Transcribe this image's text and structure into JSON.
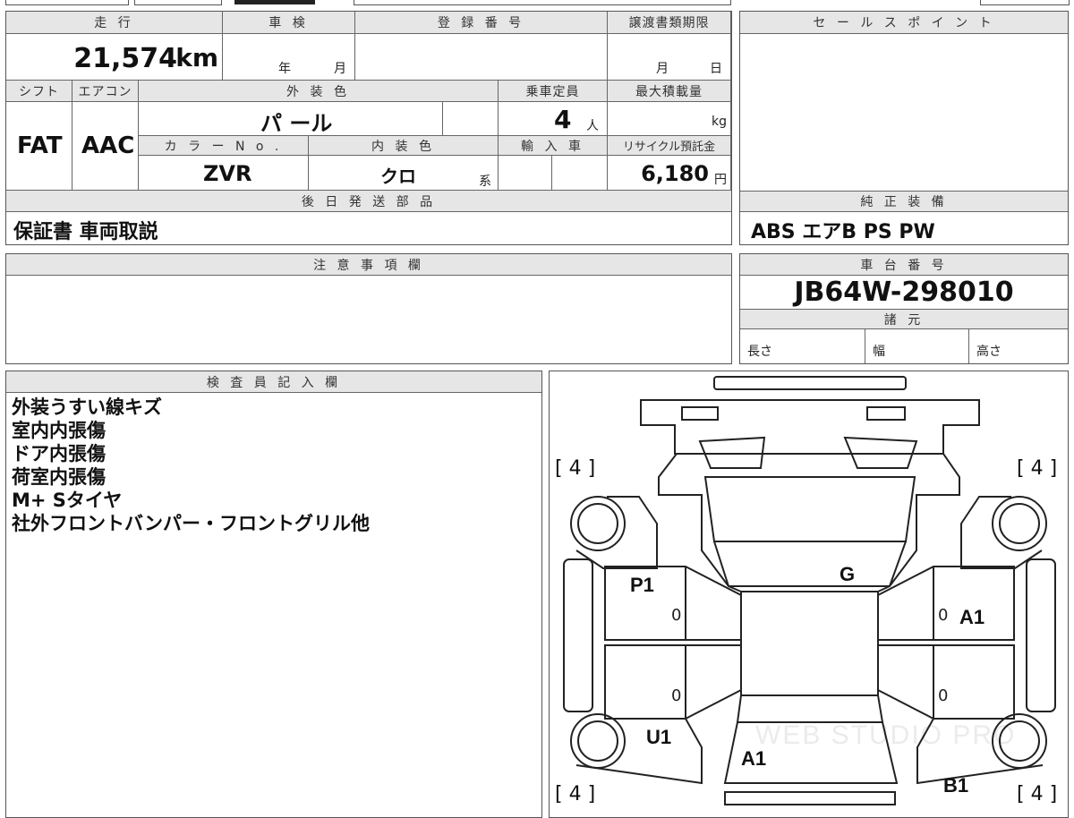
{
  "mileage": {
    "header": "走 行",
    "value": "21,574",
    "unit": "km"
  },
  "shaken": {
    "header": "車 検",
    "year_unit": "年",
    "month_unit": "月"
  },
  "registration": {
    "header": "登 録 番 号"
  },
  "transfer_deadline": {
    "header": "譲渡書類期限",
    "month_unit": "月",
    "day_unit": "日"
  },
  "sales_point": {
    "header": "セ ー ル ス ポ イ ン ト"
  },
  "shift": {
    "header": "シフト",
    "value": "FAT"
  },
  "aircon": {
    "header": "エアコン",
    "value": "AAC"
  },
  "exterior_color": {
    "header": "外 装 色",
    "value": "パ ール"
  },
  "capacity": {
    "header": "乗車定員",
    "value": "4",
    "unit": "人"
  },
  "max_load": {
    "header": "最大積載量",
    "unit": "kg"
  },
  "color_no": {
    "header": "カ ラ ー N o .",
    "value": "ZVR"
  },
  "interior_color": {
    "header": "内 装 色",
    "value": "クロ",
    "unit": "系"
  },
  "import": {
    "header": "輸 入 車"
  },
  "recycle": {
    "header": "リサイクル預託金",
    "value": "6,180",
    "unit": "円"
  },
  "later_parts": {
    "header": "後 日 発 送 部 品",
    "value": "保証書 車両取説"
  },
  "equipment": {
    "header": "純 正 装 備",
    "value": "ABS エアB PS PW"
  },
  "caution": {
    "header": "注 意 事 項 欄"
  },
  "chassis": {
    "header": "車 台 番 号",
    "value": "JB64W-298010"
  },
  "specs": {
    "header": "諸 元",
    "length": "長さ",
    "width": "幅",
    "height": "高さ"
  },
  "inspector": {
    "header": "検 査 員 記 入 欄",
    "notes": [
      "外装うすい線キズ",
      "室内内張傷",
      "ドア内張傷",
      "荷室内張傷",
      "M+ Sタイヤ",
      "社外フロントバンパー・フロントグリル他"
    ]
  },
  "diagram": {
    "tire_tl": "[ 4 ]",
    "tire_tr": "[ 4 ]",
    "tire_bl": "[ 4 ]",
    "tire_br": "[ 4 ]",
    "mark_p1": "P1",
    "mark_g": "G",
    "mark_a1_right": "A1",
    "mark_u1": "U1",
    "mark_a1_rear": "A1",
    "mark_b1": "B1",
    "zero_1": "0",
    "zero_2": "0",
    "zero_3": "0",
    "zero_4": "0",
    "watermark": "WEB STUDIO PRO"
  }
}
